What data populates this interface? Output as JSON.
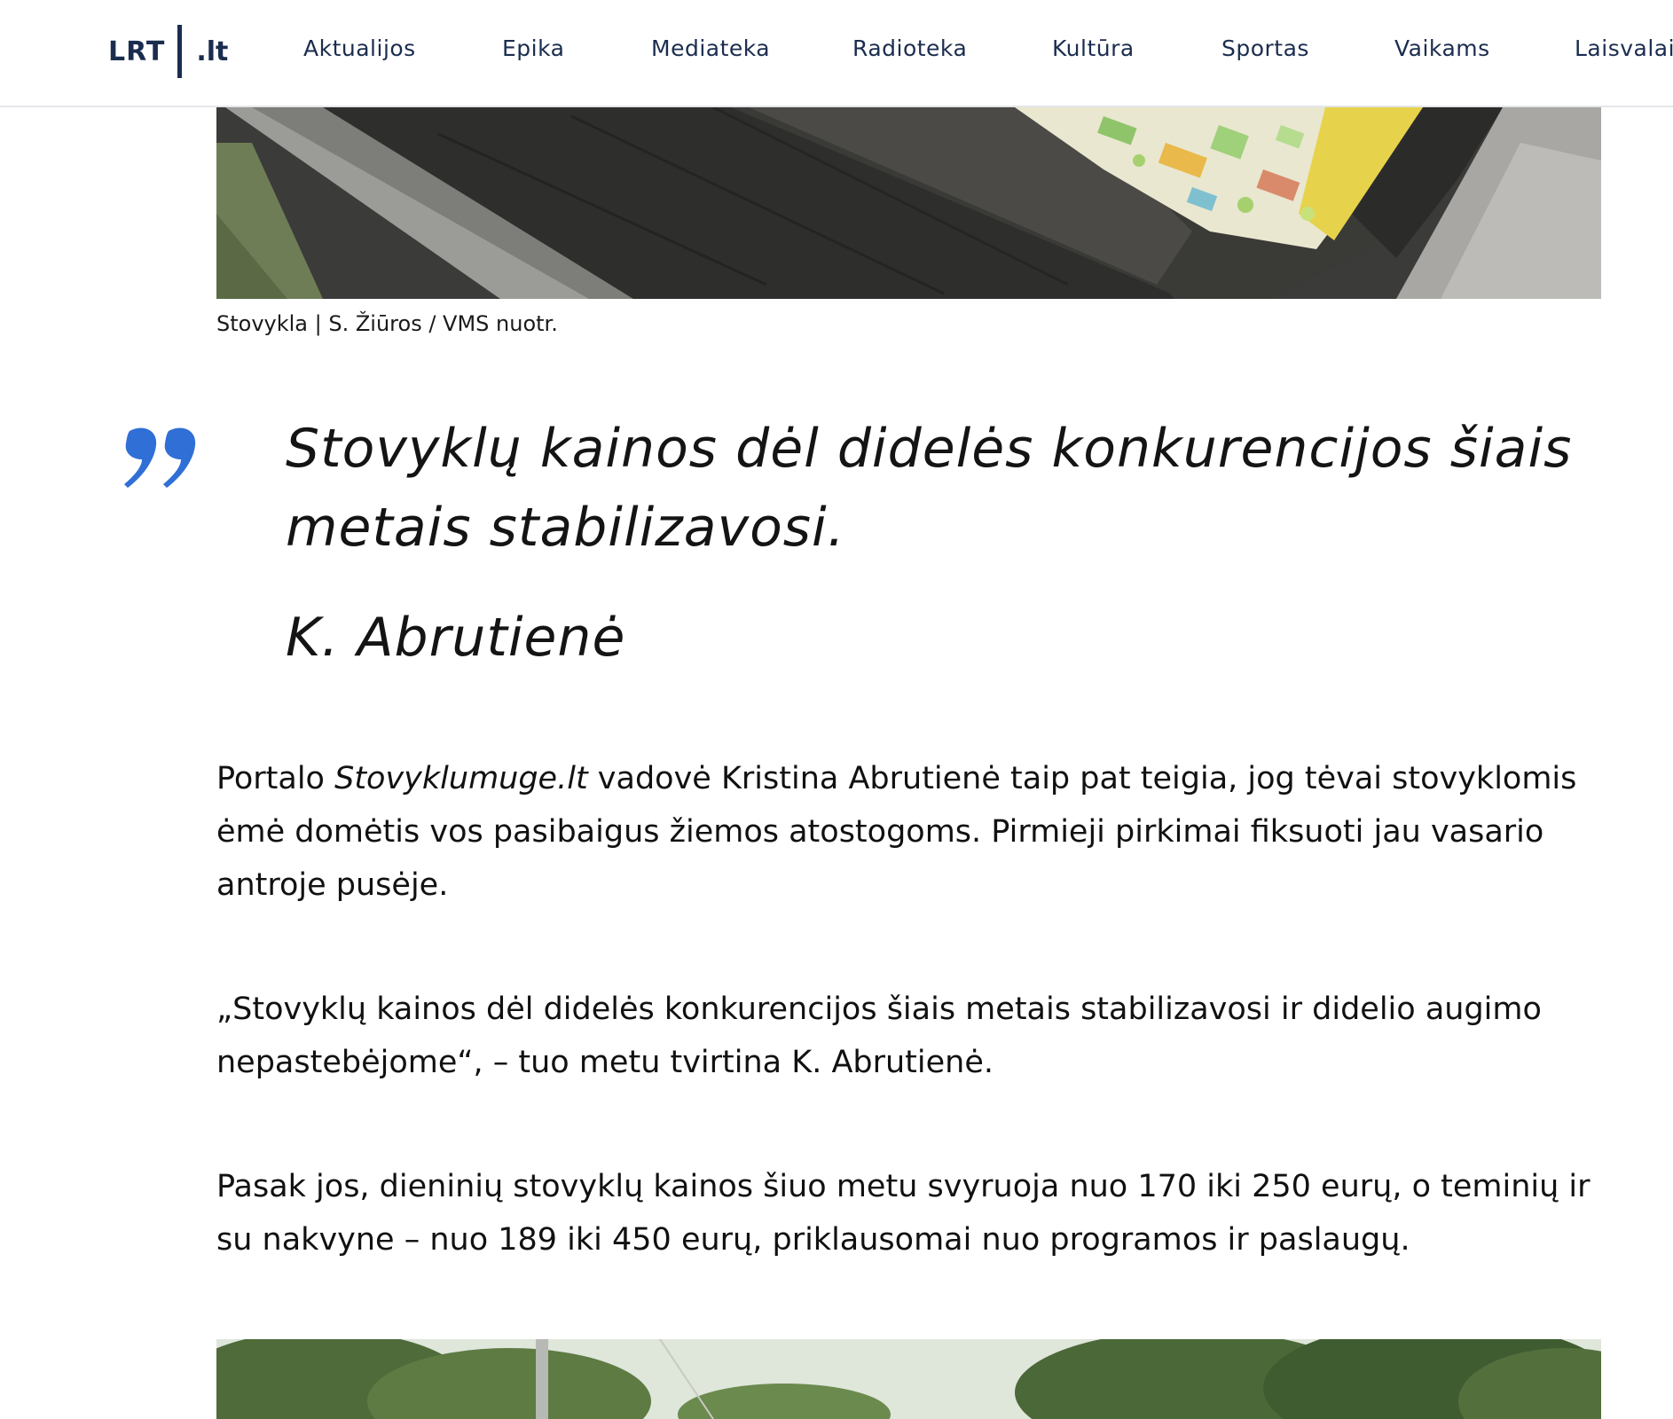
{
  "header": {
    "logo": {
      "brand": "LRT",
      "tld": ".lt"
    },
    "nav": [
      {
        "label": "Aktualijos"
      },
      {
        "label": "Epika"
      },
      {
        "label": "Mediateka"
      },
      {
        "label": "Radioteka"
      },
      {
        "label": "Kultūra"
      },
      {
        "label": "Sportas"
      },
      {
        "label": "Vaikams"
      },
      {
        "label": "Laisvalai"
      }
    ]
  },
  "article": {
    "photo_caption": "Stovykla | S. Žiūros / VMS nuotr.",
    "quote": {
      "text": "Stovyklų kainos dėl didelės konkurencijos šiais metais stabilizavosi.",
      "author": "K. Abrutienė",
      "icon": "quote-mark-icon",
      "accent_color": "#2f6fd6"
    },
    "paragraphs": [
      {
        "before": "Portalo ",
        "emphasis": "Stovyklumuge.lt",
        "after": " vadovė Kristina Abrutienė taip pat teigia, jog tėvai stovyklomis ėmė domėtis vos pasibaigus žiemos atostogoms. Pirmieji pirkimai fiksuoti jau vasario antroje pusėje."
      },
      {
        "text": "„Stovyklų kainos dėl didelės konkurencijos šiais metais stabilizavosi ir didelio augimo nepastebėjome“, – tuo metu tvirtina K. Abrutienė."
      },
      {
        "text": "Pasak jos, dieninių stovyklų kainos šiuo metu svyruoja nuo 170 iki 250 eurų, o teminių ir su nakvyne – nuo 189 iki 450 eurų, priklausomai nuo programos ir paslaugų."
      }
    ]
  },
  "colors": {
    "nav_text": "#1b2d4f",
    "body_text": "#111111",
    "quote_accent": "#2f6fd6"
  }
}
